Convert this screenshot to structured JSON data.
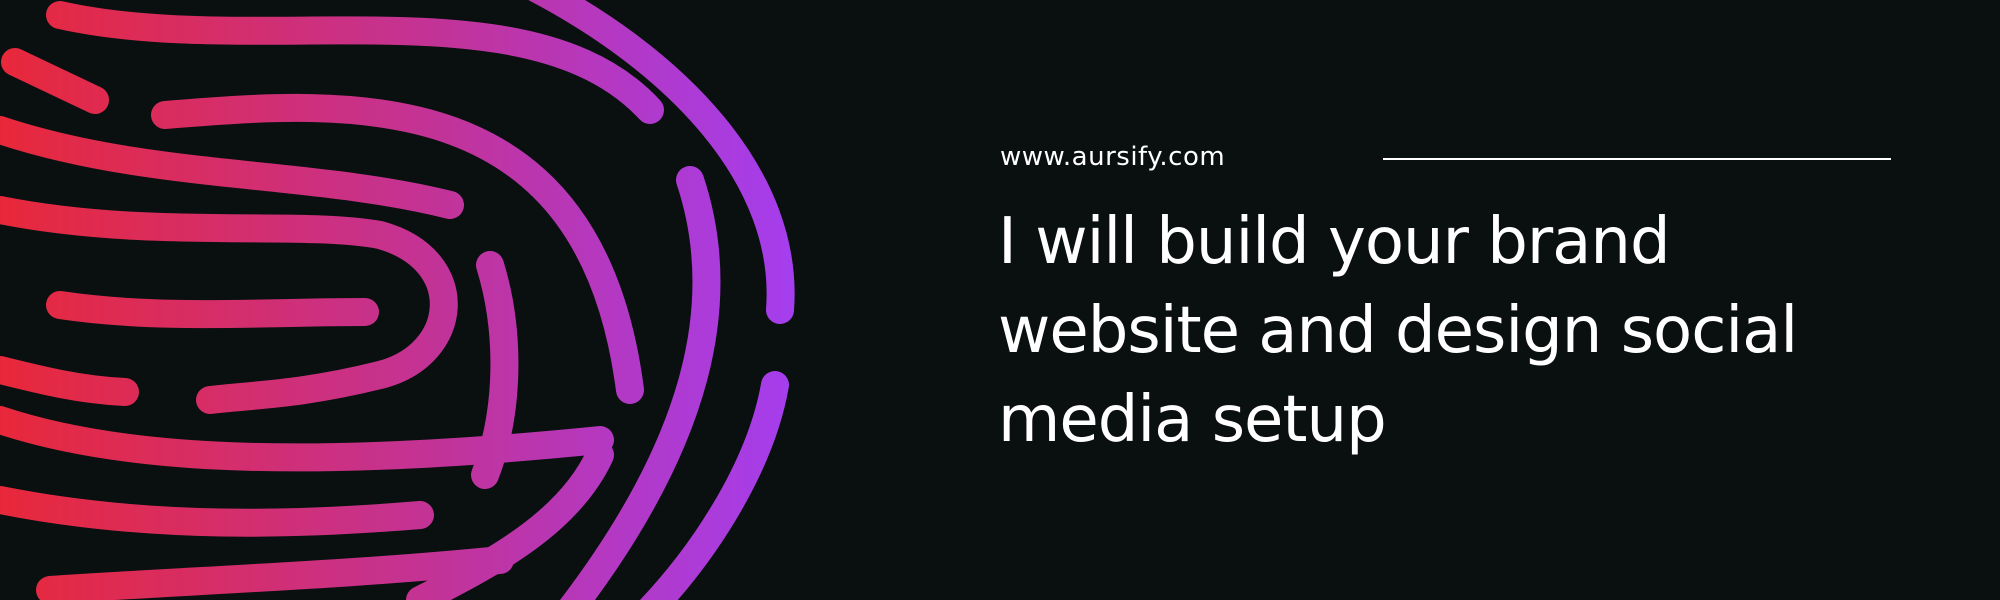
{
  "banner": {
    "url": "www.aursify.com",
    "headline": "I will build your brand website and design social media setup"
  },
  "graphic": {
    "name": "fingerprint-graphic",
    "gradient": [
      "#e8283a",
      "#c23398",
      "#a43ef0"
    ]
  },
  "colors": {
    "background": "#0a0f10",
    "text": "#ffffff"
  }
}
